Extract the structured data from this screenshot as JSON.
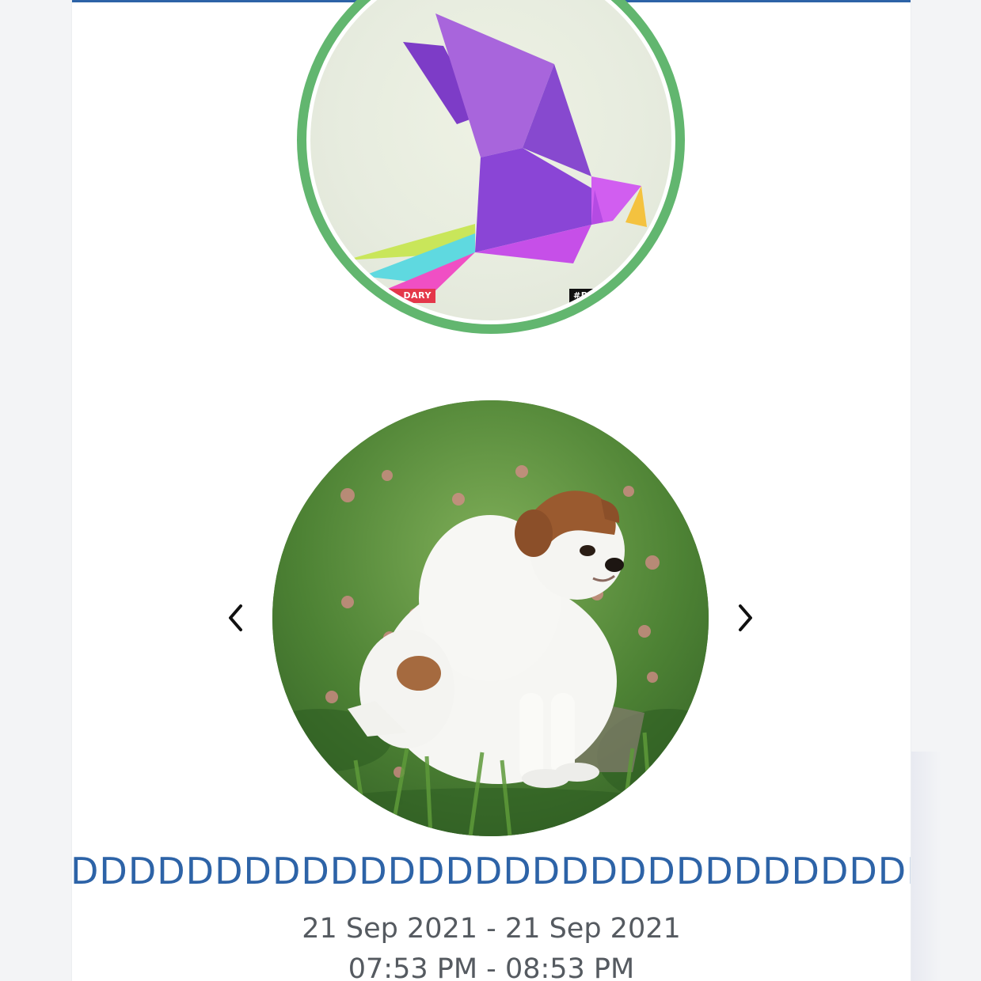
{
  "logo": {
    "tag_left": "DARY",
    "tag_right": "#POLY",
    "palette": {
      "ring": "#62b66f",
      "bird_body": "#8a45d6",
      "bird_wing": "#a865dc",
      "bird_head": "#d15ef0",
      "beak": "#f4c23f",
      "tail_lime": "#c9e65a",
      "tail_cyan": "#5fd9e0",
      "tail_pink": "#f04fc4"
    }
  },
  "carousel": {
    "prev_icon": "chevron-left-icon",
    "next_icon": "chevron-right-icon",
    "image_subject": "puppy-photo"
  },
  "event": {
    "title": "DDDDDDDDDDDDDDDDDDDDDDDDDDDDDDDD",
    "date_range": "21 Sep 2021 - 21 Sep 2021",
    "time_range": "07:53 PM - 08:53 PM"
  },
  "colors": {
    "brand_blue": "#2d63a7",
    "text_gray": "#555a60",
    "background": "#f3f4f6"
  }
}
